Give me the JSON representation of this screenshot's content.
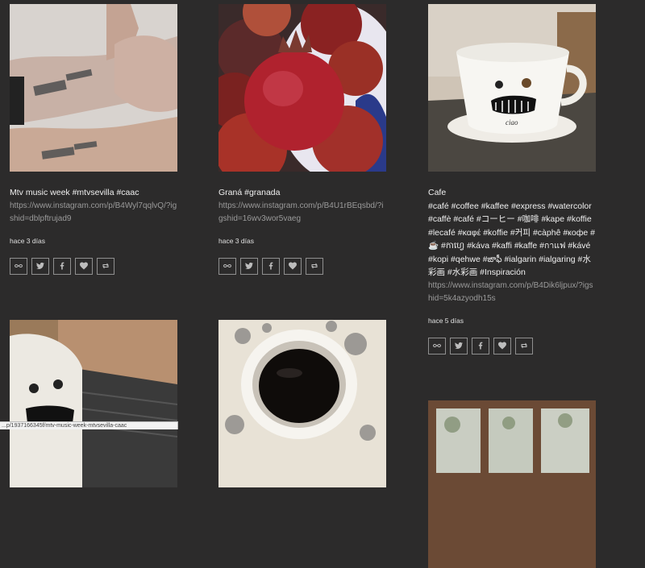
{
  "posts": [
    {
      "caption": "Mtv music week #mtvsevilla #caac",
      "link": "https://www.instagram.com/p/B4Wyl7qqlvQ/?igshid=dblpftrujad9",
      "time": "hace 3 días",
      "image": "hands-with-stamps"
    },
    {
      "caption": "Graná #granada",
      "link": "https://www.instagram.com/p/B4U1rBEqsbd/?igshid=16wv3wor5vaeg",
      "time": "hace 3 días",
      "image": "pomegranates"
    },
    {
      "caption": "Cafe\n#café #coffee #kaffee #express #watercolor #caffè #café #コーヒー #咖啡 #kape #koffie #lecafé #καφέ #koffie #커피 #càphê #кофе #☕ #កាហ្វេ #káva #kaffi #kaffe #กาแฟ #kávé #kopi #qehwe #ఙాఫీ #ialgarin #ialgaring #水彩画 #水彩画 #Inspiración",
      "link": "https://www.instagram.com/p/B4Dik6ljpux/?igshid=5k4azyodh15s",
      "time": "hace 5 días",
      "image": "coffee-cup-face"
    },
    {
      "image": "cup-on-laptop"
    },
    {
      "image": "coffee-top-view"
    },
    {
      "image": "window-view"
    }
  ],
  "actions": [
    {
      "icon": "infinity-icon",
      "name": "permalink-button"
    },
    {
      "icon": "twitter-icon",
      "name": "twitter-share-button"
    },
    {
      "icon": "facebook-icon",
      "name": "facebook-share-button"
    },
    {
      "icon": "heart-icon",
      "name": "like-button"
    },
    {
      "icon": "retweet-icon",
      "name": "repost-button"
    }
  ],
  "status_bar": {
    "url": "...p/1937166345f/mtv-music-week-mtvsevilla-caac"
  }
}
